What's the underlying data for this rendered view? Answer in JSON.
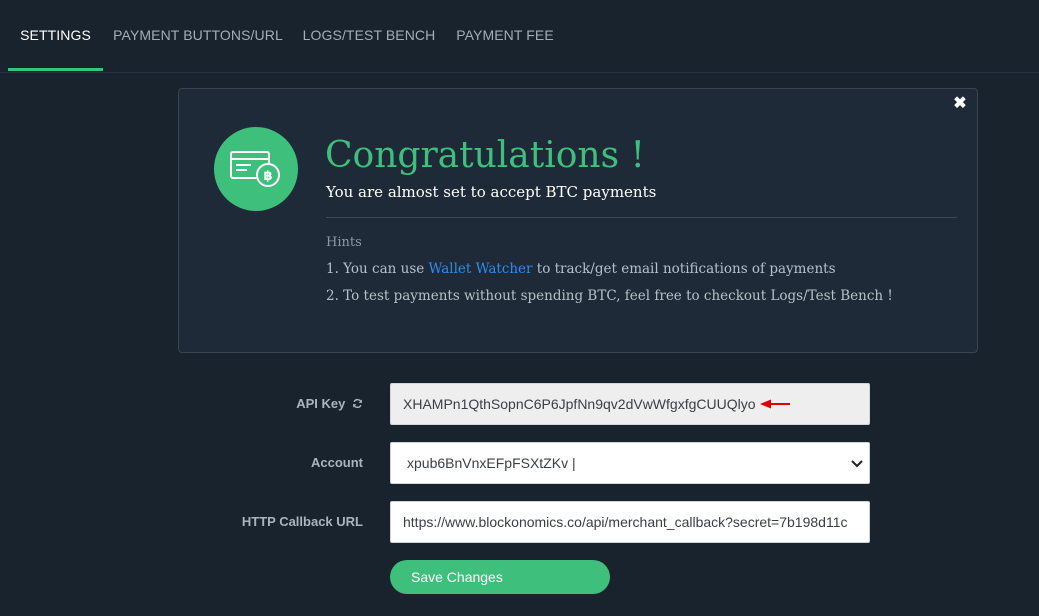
{
  "tabs": [
    {
      "label": "SETTINGS",
      "active": true
    },
    {
      "label": "PAYMENT BUTTONS/URL",
      "active": false
    },
    {
      "label": "LOGS/TEST BENCH",
      "active": false
    },
    {
      "label": "PAYMENT FEE",
      "active": false
    }
  ],
  "banner": {
    "close_icon": "close-icon",
    "badge_icon": "card-bitcoin-icon",
    "title": "Congratulations !",
    "subtitle": "You are almost set to accept BTC payments",
    "hints_title": "Hints",
    "hint1_prefix": "1. You can use ",
    "hint1_link": "Wallet Watcher",
    "hint1_suffix": " to track/get email notifications of payments",
    "hint2": "2. To test payments without spending BTC, feel free to checkout Logs/Test Bench !"
  },
  "form": {
    "api_key_label": "API Key",
    "api_key_value": "XHAMPn1QthSopnC6P6JpfNn9qv2dVwWfgxfgCUUQlyo",
    "account_label": "Account",
    "account_value": "xpub6BnVnxEFpFSXtZKv |",
    "callback_label": "HTTP Callback URL",
    "callback_value": "https://www.blockonomics.co/api/merchant_callback?secret=7b198d11c",
    "save_label": "Save Changes"
  },
  "colors": {
    "accent": "#3ec07c",
    "link": "#2f8ce8",
    "annotation_arrow": "#e00000"
  }
}
